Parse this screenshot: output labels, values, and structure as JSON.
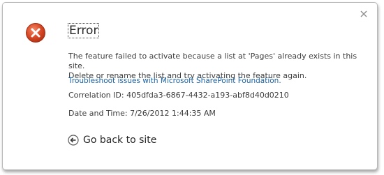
{
  "dialog": {
    "title": "Error",
    "message_line1": "The feature failed to activate because a list at 'Pages' already exists in this site.",
    "message_line2": "Delete or rename the list and try activating the feature again.",
    "help_link": "Troubleshoot issues with Microsoft SharePoint Foundation.",
    "correlation": "Correlation ID: 405dfda3-6867-4432-a193-abf8d40d0210",
    "datetime": "Date and Time: 7/26/2012 1:44:35 AM",
    "back_label": "Go back to site",
    "colors": {
      "error_red": "#d44a2a",
      "link_blue": "#1a63a7"
    },
    "icons": {
      "close": "close-icon",
      "error": "error-icon",
      "back": "back-arrow-icon"
    }
  }
}
